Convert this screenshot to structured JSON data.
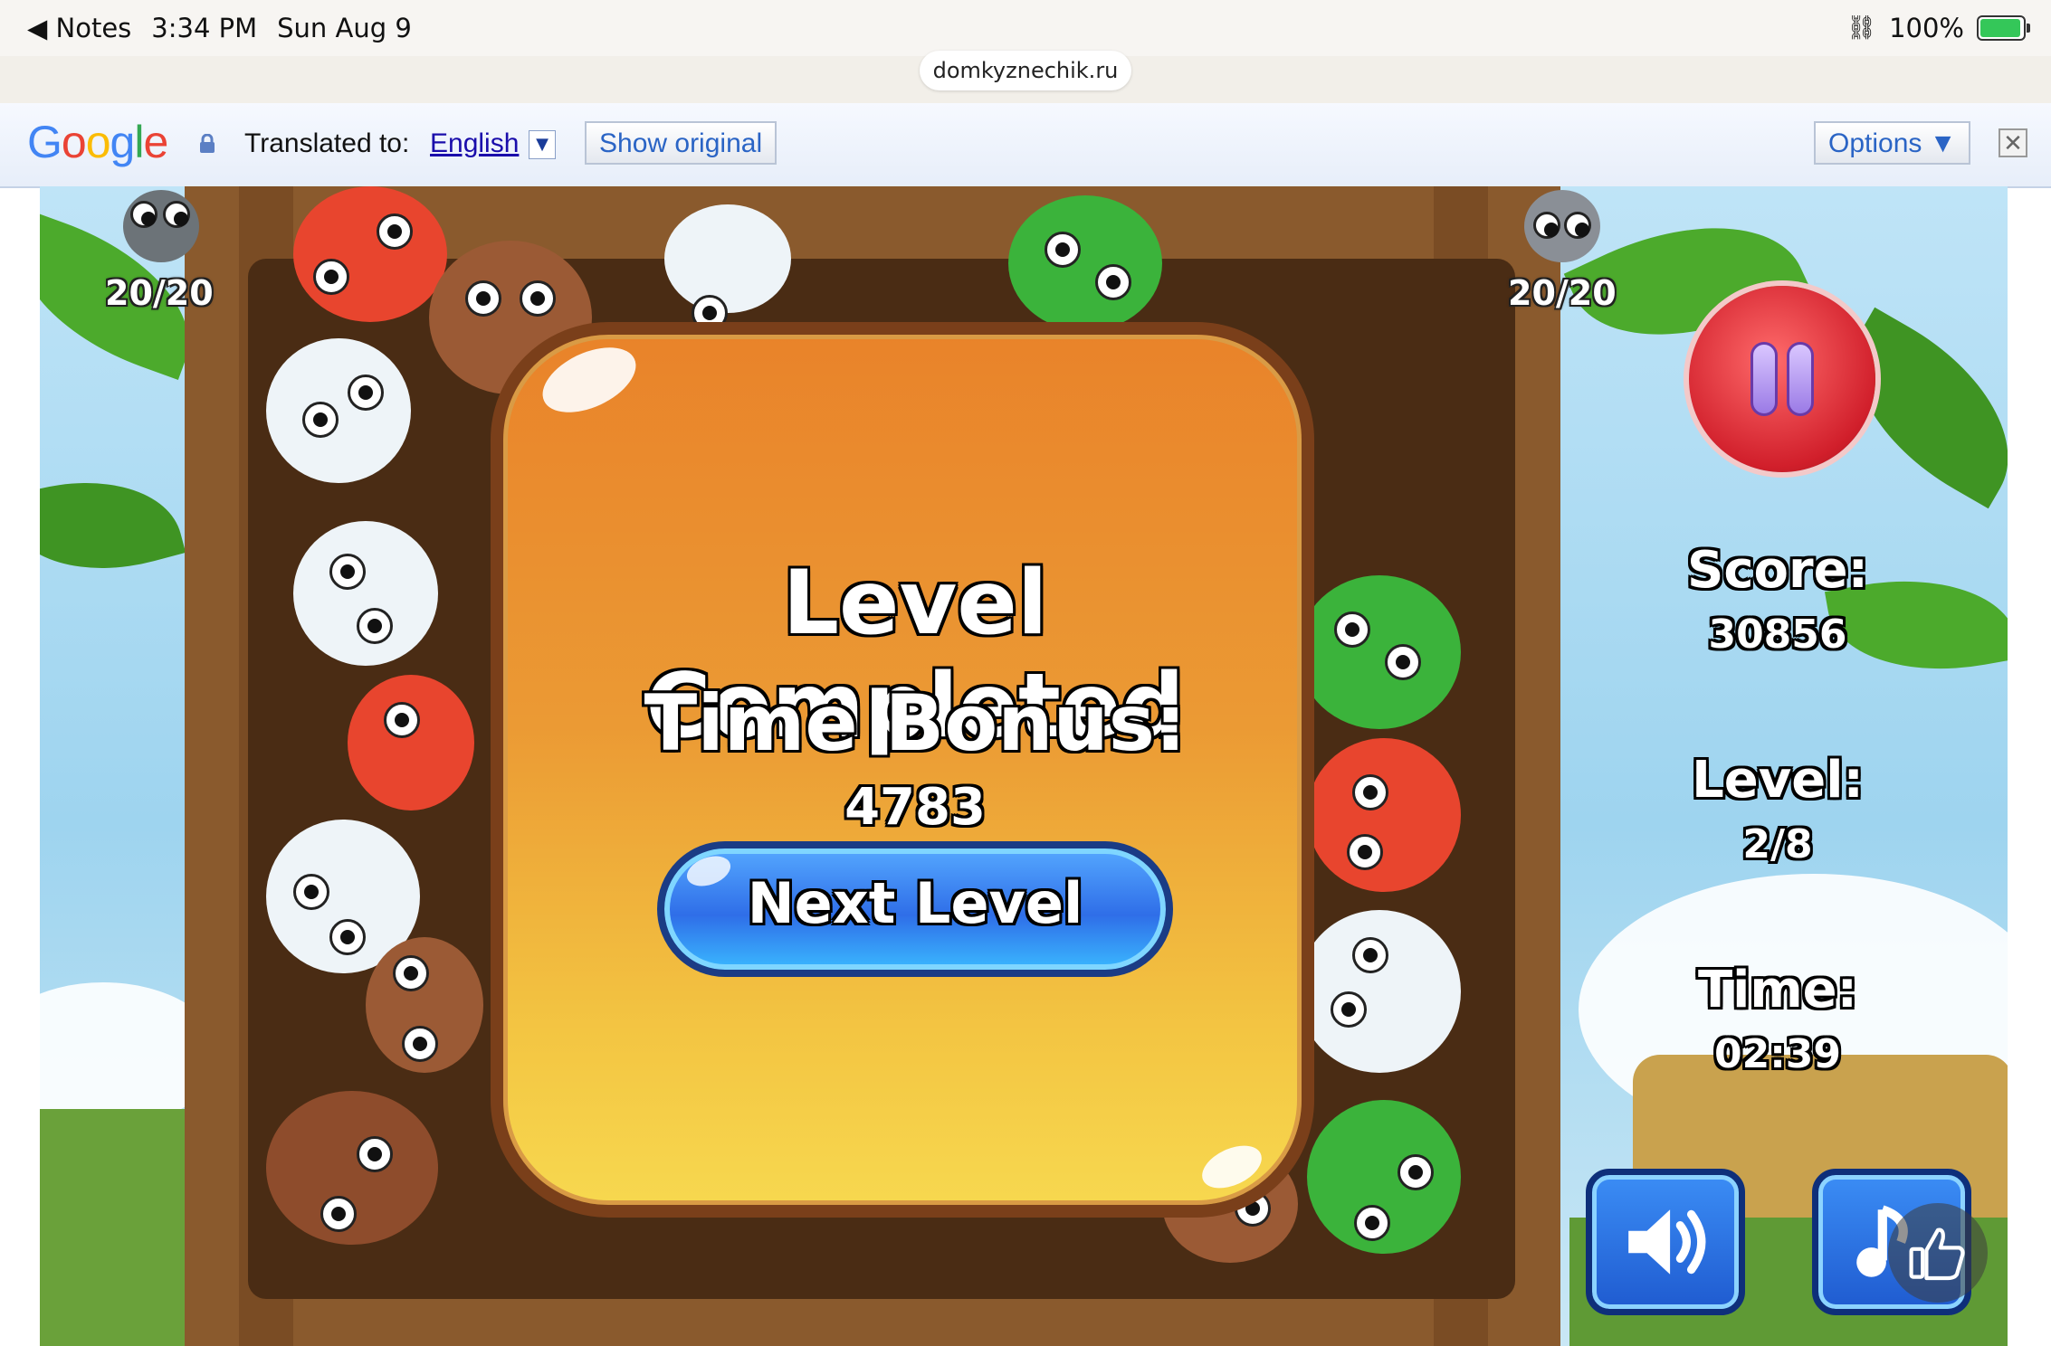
{
  "status_bar": {
    "back_app": "◀ Notes",
    "time": "3:34 PM",
    "date": "Sun Aug 9",
    "battery": "100%",
    "battery_level": 1.0
  },
  "browser": {
    "url": "domkyznechik.ru"
  },
  "translate_bar": {
    "logo": "Google",
    "translated_to": "Translated to:",
    "language": "English",
    "show_original": "Show original",
    "options": "Options ▼",
    "close": "✕"
  },
  "game": {
    "left_counter": "20/20",
    "right_counter": "20/20",
    "panel": {
      "title": "Level Completed",
      "time_bonus_label": "Time Bonus:",
      "time_bonus_value": "4783",
      "next_button": "Next Level"
    },
    "hud": {
      "score_label": "Score:",
      "score_value": "30856",
      "level_label": "Level:",
      "level_value": "2/8",
      "time_label": "Time:",
      "time_value": "02:39"
    },
    "icons": [
      "crocodile-icon",
      "raccoon-icon",
      "pause-icon",
      "sound-icon",
      "music-icon",
      "thumbs-up-icon"
    ]
  },
  "colors": {
    "panel": "#eb9a34",
    "button": "#2f6ee8",
    "pause": "#d11f2b",
    "sound": "#1f5bd0"
  }
}
